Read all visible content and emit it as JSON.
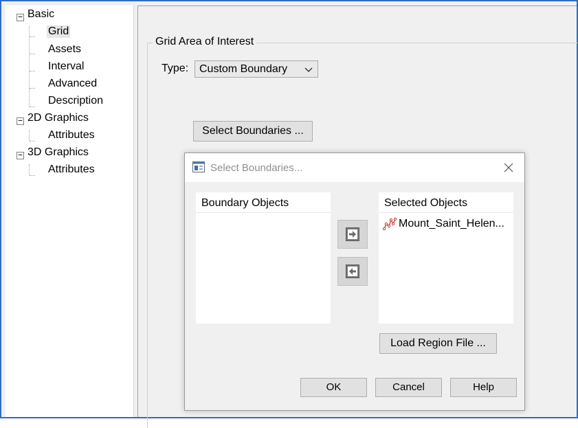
{
  "tree": {
    "items": [
      {
        "label": "Basic",
        "toggle": "−"
      },
      {
        "label": "Grid"
      },
      {
        "label": "Assets"
      },
      {
        "label": "Interval"
      },
      {
        "label": "Advanced"
      },
      {
        "label": "Description"
      },
      {
        "label": "2D Graphics",
        "toggle": "−"
      },
      {
        "label": "Attributes"
      },
      {
        "label": "3D Graphics",
        "toggle": "−"
      },
      {
        "label": "Attributes"
      }
    ]
  },
  "grid_area": {
    "title": "Grid Area of Interest",
    "type_label": "Type:",
    "type_value": "Custom Boundary",
    "select_boundaries_button": "Select Boundaries ..."
  },
  "dialog": {
    "title": "Select Boundaries...",
    "boundary_objects_header": "Boundary Objects",
    "selected_objects_header": "Selected Objects",
    "selected_items": [
      {
        "label": "Mount_Saint_Helen...",
        "icon": "boundary-polyline-icon"
      }
    ],
    "load_region_button": "Load Region File ...",
    "ok_button": "OK",
    "cancel_button": "Cancel",
    "help_button": "Help"
  },
  "colors": {
    "frame_border": "#2e6bc4",
    "boundary_icon": "#c0392b"
  }
}
